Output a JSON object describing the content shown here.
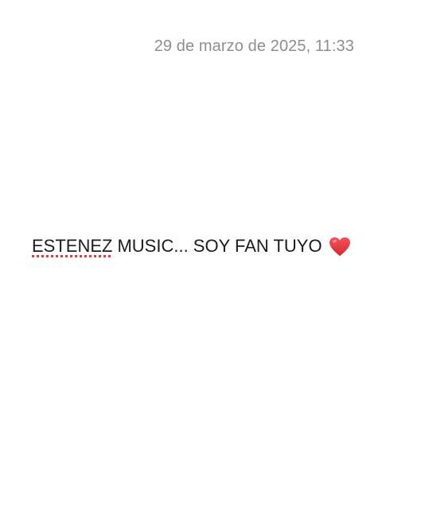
{
  "note": {
    "timestamp": "29 de marzo de 2025, 11:33",
    "misspelled_word": "ESTENEZ",
    "text_after": "MUSIC... SOY FAN TUYO",
    "emoji": "red-heart-icon",
    "emoji_color": "#e0393e",
    "spellcheck_underline_color": "#e0393e"
  }
}
